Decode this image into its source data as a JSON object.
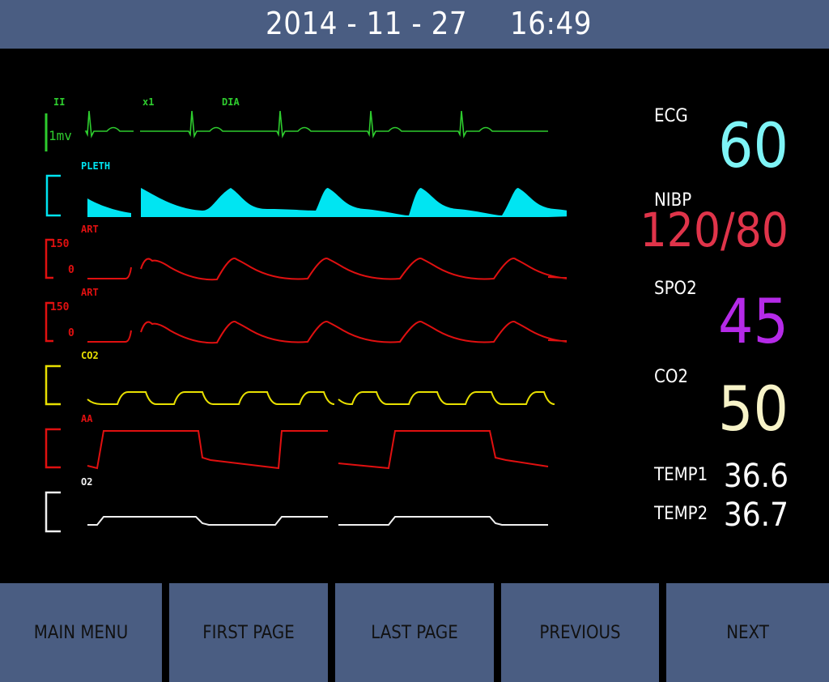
{
  "header": {
    "date": "2014 - 11 - 27",
    "time": "16:49"
  },
  "waveforms": {
    "ecg": {
      "lead": "II",
      "gain": "x1",
      "mode": "DIA",
      "scale": "1mv",
      "color": "#2ecc2e"
    },
    "pleth": {
      "label": "PLETH",
      "color": "#00e5f2"
    },
    "art1": {
      "label": "ART",
      "scale_high": "150",
      "scale_low": "0",
      "color": "#e01010"
    },
    "art2": {
      "label": "ART",
      "scale_high": "150",
      "scale_low": "0",
      "color": "#e01010"
    },
    "co2": {
      "label": "CO2",
      "color": "#e8e000"
    },
    "aa": {
      "label": "AA",
      "color": "#e01010"
    },
    "o2": {
      "label": "O2",
      "color": "#f0f0f0"
    }
  },
  "parameters": {
    "ecg": {
      "label": "ECG",
      "value": "60",
      "color": "#7ef4f6"
    },
    "nibp": {
      "label": "NIBP",
      "value": "120/80",
      "color": "#e0344a"
    },
    "spo2": {
      "label": "SPO2",
      "value": "45",
      "color": "#b52ae8"
    },
    "co2": {
      "label": "CO2",
      "value": "50",
      "color": "#f7f3c8"
    },
    "temp1": {
      "label": "TEMP1",
      "value": "36.6"
    },
    "temp2": {
      "label": "TEMP2",
      "value": "36.7"
    }
  },
  "nav": {
    "main_menu": "MAIN MENU",
    "first_page": "FIRST PAGE",
    "last_page": "LAST PAGE",
    "previous": "PREVIOUS",
    "next": "NEXT"
  },
  "theme": {
    "panel": "#4a5d82",
    "background": "#000000"
  }
}
